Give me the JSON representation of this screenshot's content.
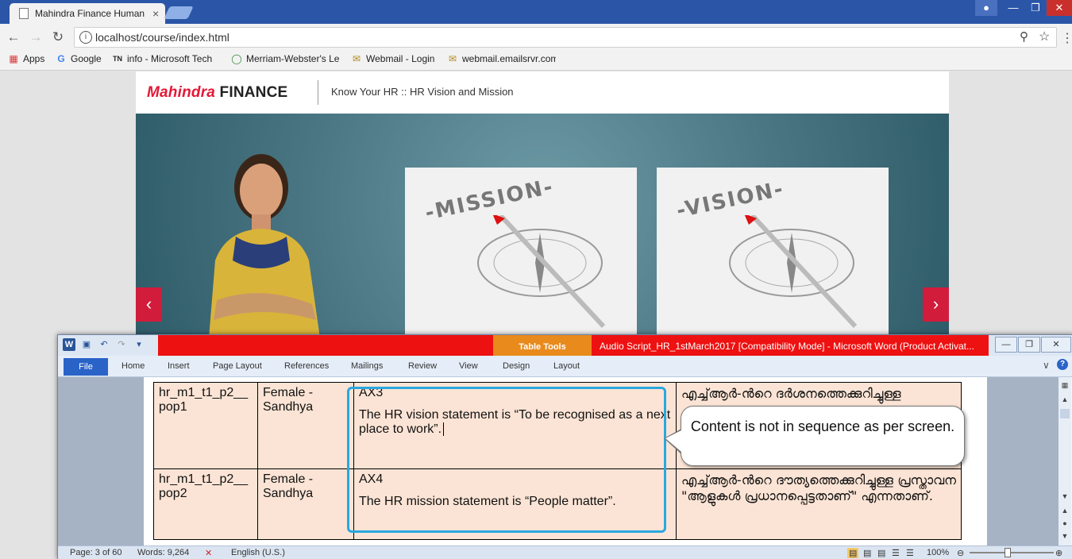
{
  "browser": {
    "tab_title": "Mahindra Finance Human",
    "url": "localhost/course/index.html",
    "bookmarks": [
      {
        "label": "Apps"
      },
      {
        "label": "Google"
      },
      {
        "label": "info - Microsoft Tech"
      },
      {
        "label": "Merriam-Webster's Le"
      },
      {
        "label": "Webmail - Login"
      },
      {
        "label": "webmail.emailsrvr.com"
      }
    ]
  },
  "site": {
    "logo_brand": "Mahindra",
    "logo_suffix": "FINANCE",
    "header_title": "Know Your HR :: HR Vision and Mission",
    "card_mission": "-MISSION-",
    "card_vision": "-VISION-"
  },
  "word": {
    "contextual_tab": "Table Tools",
    "title": "Audio Script_HR_1stMarch2017 [Compatibility Mode] - Microsoft Word (Product Activat...",
    "tabs": {
      "file": "File",
      "home": "Home",
      "insert": "Insert",
      "page_layout": "Page Layout",
      "references": "References",
      "mailings": "Mailings",
      "review": "Review",
      "view": "View",
      "design": "Design",
      "layout": "Layout"
    },
    "rows": [
      {
        "id": "hr_m1_t1_p2__pop1",
        "voice": "Female - Sandhya",
        "code": "AX3",
        "text": "The HR vision statement is “To be recognised as a next place to work”.",
        "translation": "എച്ച്ആർ-ന്‍റെ ദർശനത്തെക്കുറിച്ചുള്ള"
      },
      {
        "id": "hr_m1_t1_p2__pop2",
        "voice": "Female - Sandhya",
        "code": "AX4",
        "text": "The HR mission statement is “People matter”.",
        "translation": "എച്ച്ആർ-ന്‍റെ ദൗത്യത്തെക്കുറിച്ചുള്ള പ്രസ്താവന \"ആളുകൾ പ്രധാനപ്പെട്ടതാണ്\" എന്നതാണ്."
      }
    ],
    "status": {
      "page": "Page: 3 of 60",
      "words": "Words: 9,264",
      "language": "English (U.S.)",
      "zoom": "100%"
    }
  },
  "annotation": {
    "callout": "Content is not in sequence as per screen."
  },
  "colors": {
    "brand_red": "#e31837",
    "chrome_blue": "#2b56a8",
    "word_red_band": "#ee1111",
    "table_fill": "#fbe4d5",
    "highlight_blue": "#29a8e0"
  }
}
